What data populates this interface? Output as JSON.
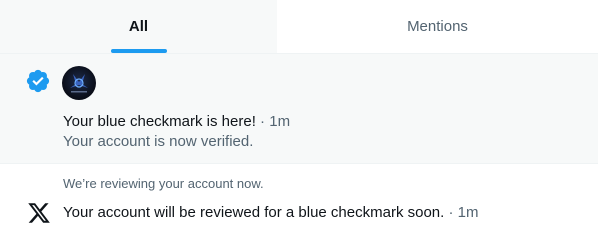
{
  "tabs": {
    "all_label": "All",
    "mentions_label": "Mentions"
  },
  "notifications": [
    {
      "icon": "verified-badge-icon",
      "title": "Your blue checkmark is here!",
      "separator": " · ",
      "time": "1m",
      "subtitle": "Your account is now verified."
    },
    {
      "icon": "x-logo-icon",
      "header": "We’re reviewing your account now.",
      "text": "Your account will be reviewed for a blue checkmark soon.",
      "separator": " · ",
      "time": "1m"
    }
  ],
  "colors": {
    "accent": "#1d9bf0",
    "text": "#0f1419",
    "muted": "#536471",
    "highlight_bg": "#f7f9f9"
  }
}
